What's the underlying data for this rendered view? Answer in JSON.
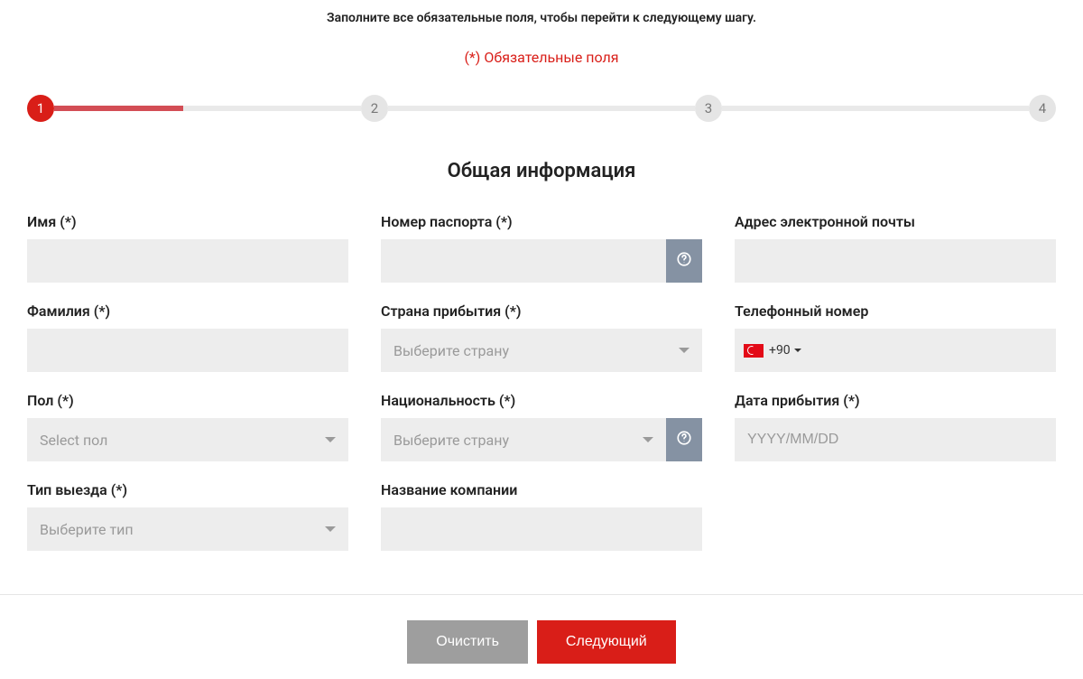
{
  "header": {
    "instruction": "Заполните все обязательные поля, чтобы перейти к следующему шагу.",
    "required_note": "(*) Обязательные поля"
  },
  "stepper": {
    "steps": [
      "1",
      "2",
      "3",
      "4"
    ],
    "active_index": 0
  },
  "section": {
    "title": "Общая информация"
  },
  "fields": {
    "first_name": {
      "label": "Имя (*)",
      "value": ""
    },
    "last_name": {
      "label": "Фамилия (*)",
      "value": ""
    },
    "gender": {
      "label": "Пол (*)",
      "placeholder": "Select пол"
    },
    "exit_type": {
      "label": "Тип выезда (*)",
      "placeholder": "Выберите тип"
    },
    "passport": {
      "label": "Номер паспорта (*)",
      "value": ""
    },
    "arrival_country": {
      "label": "Страна прибытия (*)",
      "placeholder": "Выберите страну"
    },
    "nationality": {
      "label": "Национальность (*)",
      "placeholder": "Выберите страну"
    },
    "company": {
      "label": "Название компании",
      "value": ""
    },
    "email": {
      "label": "Адрес электронной почты",
      "value": ""
    },
    "phone": {
      "label": "Телефонный номер",
      "dial_code": "+90",
      "value": ""
    },
    "arrival_date": {
      "label": "Дата прибытия (*)",
      "placeholder": "YYYY/MM/DD",
      "value": ""
    }
  },
  "actions": {
    "clear": "Очистить",
    "next": "Следующий"
  }
}
